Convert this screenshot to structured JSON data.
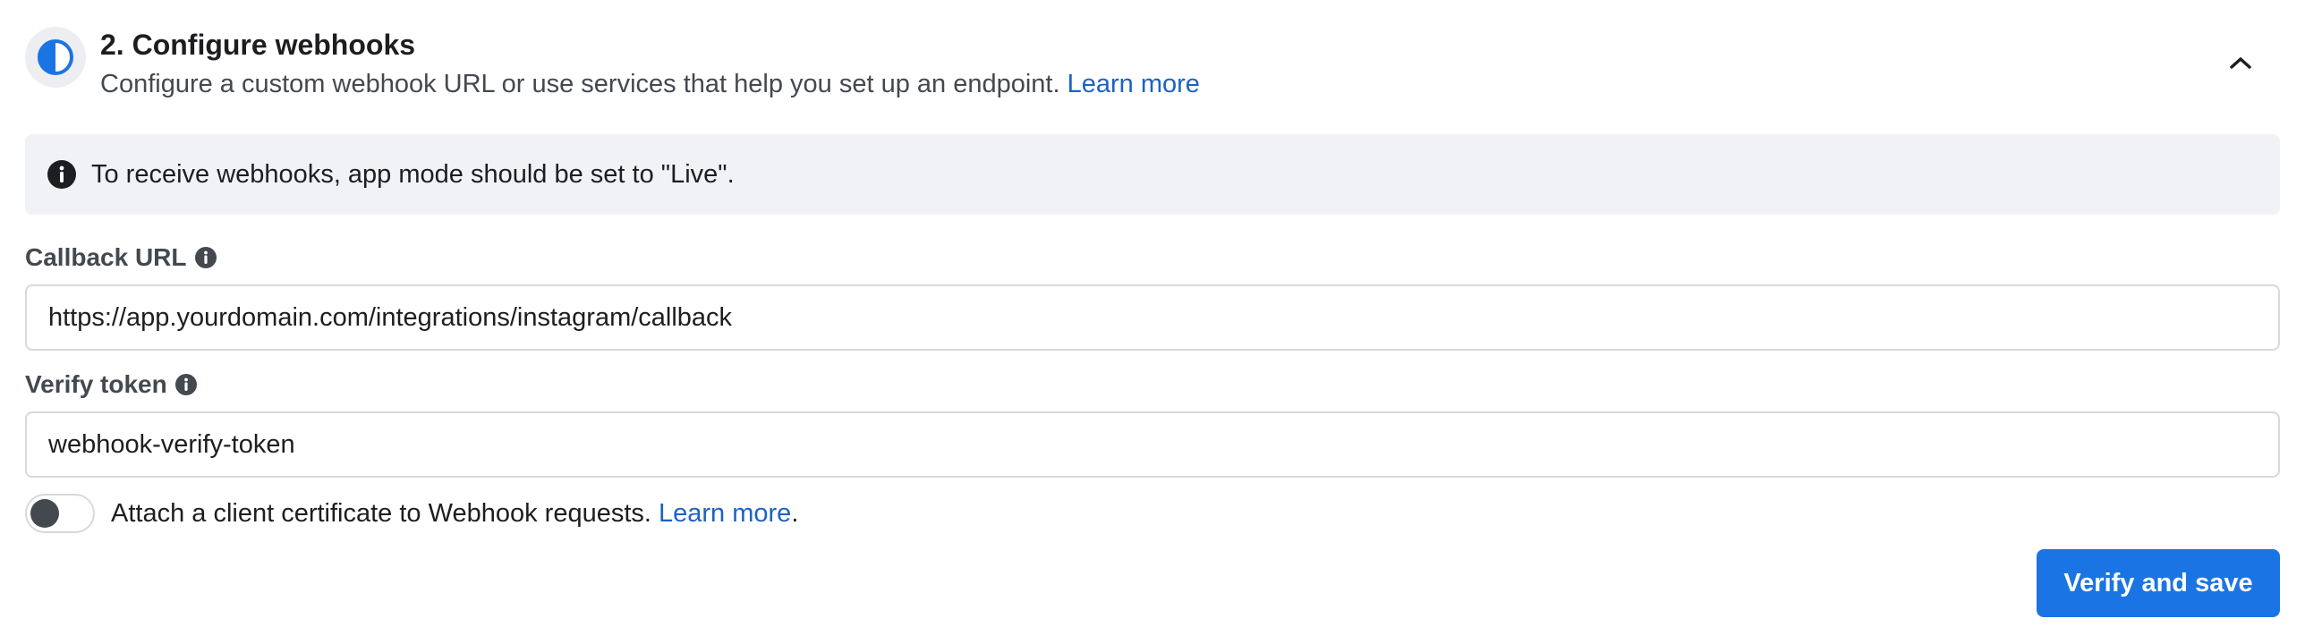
{
  "section": {
    "step_title": "2. Configure webhooks",
    "subtitle": "Configure a custom webhook URL or use services that help you set up an endpoint.",
    "subtitle_link": "Learn more",
    "step_icon": "half-circle-progress-icon",
    "collapse_icon": "chevron-up-icon"
  },
  "banner": {
    "icon": "info-icon",
    "text": "To receive webhooks, app mode should be set to \"Live\"."
  },
  "callback_url": {
    "label": "Callback URL",
    "value": "https://app.yourdomain.com/integrations/instagram/callback",
    "info_icon": "info-icon"
  },
  "verify_token": {
    "label": "Verify token",
    "value": "webhook-verify-token",
    "info_icon": "info-icon"
  },
  "certificate": {
    "text": "Attach a client certificate to Webhook requests.",
    "link": "Learn more",
    "link_suffix": ".",
    "toggle_on": false
  },
  "actions": {
    "primary_label": "Verify and save"
  },
  "colors": {
    "accent": "#1b74e4",
    "link": "#1d62c4",
    "banner_bg": "#f0f2f5"
  }
}
